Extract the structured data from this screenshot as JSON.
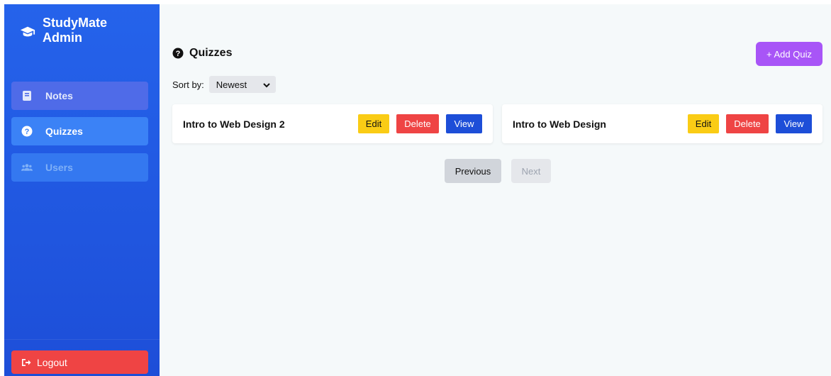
{
  "sidebar": {
    "brand": {
      "line1": "StudyMate",
      "line2": "Admin",
      "icon": "graduation-cap-icon"
    },
    "items": [
      {
        "label": "Notes",
        "icon": "book-icon"
      },
      {
        "label": "Quizzes",
        "icon": "question-circle-icon",
        "active": true
      },
      {
        "label": "Users",
        "icon": "users-icon"
      }
    ],
    "logout": {
      "label": "Logout",
      "icon": "sign-out-icon"
    }
  },
  "main": {
    "title": "Quizzes",
    "title_icon": "question-circle-icon",
    "add_button": "+ Add Quiz",
    "sort": {
      "label": "Sort by:",
      "selected": "Newest"
    },
    "quizzes": [
      {
        "title": "Intro to Web Design 2",
        "edit": "Edit",
        "delete": "Delete",
        "view": "View"
      },
      {
        "title": "Intro to Web Design",
        "edit": "Edit",
        "delete": "Delete",
        "view": "View"
      }
    ],
    "pagination": {
      "previous": "Previous",
      "next": "Next",
      "next_disabled": true
    }
  },
  "colors": {
    "sidebar": "#2563eb",
    "active_nav": "#3b82f6",
    "add_button": "#a855f7",
    "edit": "#facc15",
    "delete": "#ef4444",
    "view": "#1d4ed8",
    "logout": "#ef4444"
  }
}
